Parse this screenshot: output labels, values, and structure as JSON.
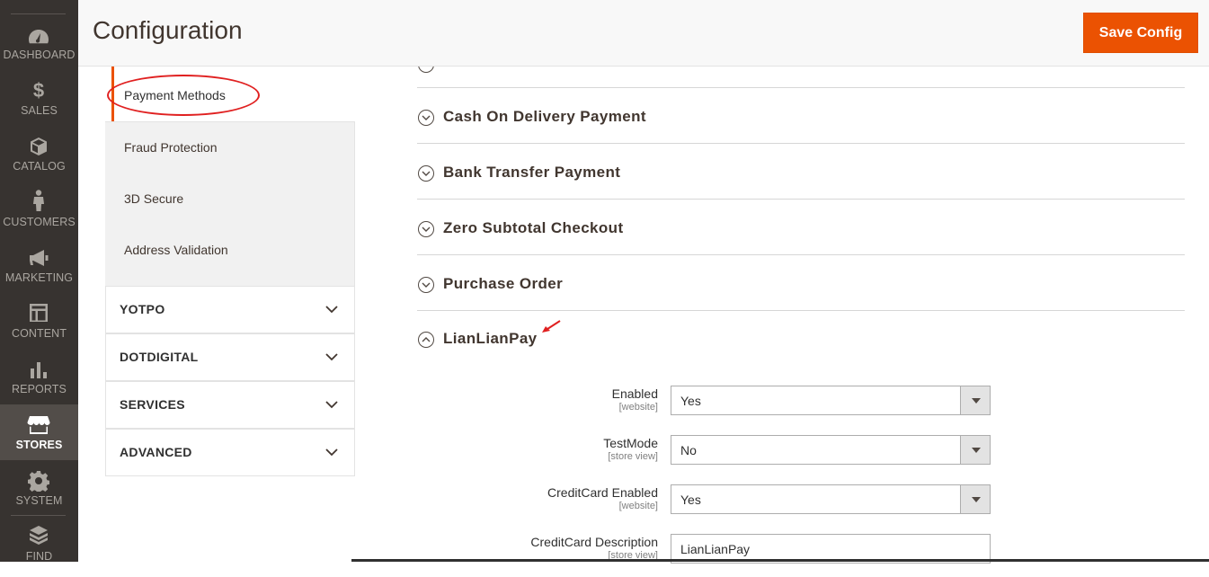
{
  "nav": {
    "items": [
      {
        "label": "DASHBOARD",
        "icon": "dashboard-icon"
      },
      {
        "label": "SALES",
        "icon": "dollar-icon"
      },
      {
        "label": "CATALOG",
        "icon": "cube-icon"
      },
      {
        "label": "CUSTOMERS",
        "icon": "person-icon"
      },
      {
        "label": "MARKETING",
        "icon": "megaphone-icon"
      },
      {
        "label": "CONTENT",
        "icon": "layout-icon"
      },
      {
        "label": "REPORTS",
        "icon": "bar-chart-icon"
      },
      {
        "label": "STORES",
        "icon": "store-icon"
      },
      {
        "label": "SYSTEM",
        "icon": "gear-icon"
      },
      {
        "label": "FIND",
        "icon": "partners-icon"
      }
    ],
    "active": "STORES"
  },
  "header": {
    "title": "Configuration",
    "save_label": "Save Config"
  },
  "tabs": {
    "active_label": "Payment Methods",
    "subtabs": [
      "Fraud Protection",
      "3D Secure",
      "Address Validation"
    ],
    "sections": [
      "YOTPO",
      "DOTDIGITAL",
      "SERVICES",
      "ADVANCED"
    ]
  },
  "groups": [
    {
      "title": "Cash On Delivery Payment"
    },
    {
      "title": "Bank Transfer Payment"
    },
    {
      "title": "Zero Subtotal Checkout"
    },
    {
      "title": "Purchase Order"
    }
  ],
  "open_group": {
    "title": "LianLianPay",
    "fields": [
      {
        "label": "Enabled",
        "scope": "[website]",
        "value": "Yes"
      },
      {
        "label": "TestMode",
        "scope": "[store view]",
        "value": "No"
      },
      {
        "label": "CreditCard Enabled",
        "scope": "[website]",
        "value": "Yes"
      },
      {
        "label": "CreditCard Description",
        "scope": "[store view]",
        "value": "LianLianPay"
      }
    ]
  },
  "colors": {
    "accent": "#eb5202",
    "nav_bg": "#373330",
    "annotation": "#e02020"
  }
}
